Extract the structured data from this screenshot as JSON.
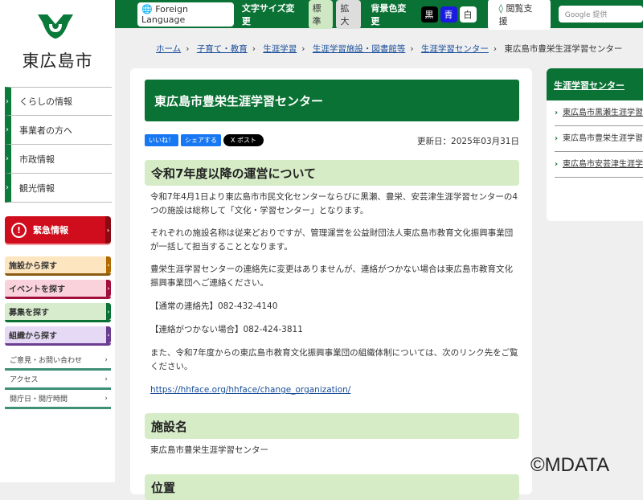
{
  "header": {
    "city_name": "東広島市",
    "foreign_language": "Foreign Language",
    "font_size_label": "文字サイズ変更",
    "font_standard": "標準",
    "font_large": "拡大",
    "bg_color_label": "背景色変更",
    "bg_black": "黒",
    "bg_blue": "青",
    "bg_white": "白",
    "browse_support": "閲覧支援",
    "search_placeholder": "Google 提供"
  },
  "global_nav": [
    "くらしの情報",
    "事業者の方へ",
    "市政情報",
    "観光情報"
  ],
  "emergency": "緊急情報",
  "find_buttons": [
    {
      "label": "施設から探す",
      "bg": "#fde5c0",
      "accent": "#b06a00"
    },
    {
      "label": "イベントを探す",
      "bg": "#fad2dc",
      "accent": "#a0103a"
    },
    {
      "label": "募集を探す",
      "bg": "#d6eccc",
      "accent": "#0a7234"
    },
    {
      "label": "組織から探す",
      "bg": "#e5d9f5",
      "accent": "#6a3d91"
    }
  ],
  "side_links": [
    "ご意見・お問い合わせ",
    "アクセス",
    "開庁日・開庁時間"
  ],
  "breadcrumb": {
    "items": [
      "ホーム",
      "子育て・教育",
      "生涯学習",
      "生涯学習施設・図書館等",
      "生涯学習センター"
    ],
    "current": "東広島市豊栄生涯学習センター"
  },
  "page": {
    "title": "東広島市豊栄生涯学習センター",
    "like": "いいね！",
    "share": "シェアする",
    "post": "X ポスト",
    "updated": "更新日：2025年03月31日",
    "section1": {
      "heading": "令和7年度以降の運営について",
      "paragraphs": [
        "令和7年4月1日より東広島市市民文化センターならびに黒瀬、豊栄、安芸津生涯学習センターの4つの施設は総称して「文化・学習センター」となります。",
        "それぞれの施設名称は従来どおりですが、管理運営を公益財団法人東広島市教育文化振興事業団が一括して担当することとなります。",
        "豊栄生涯学習センターの連絡先に変更はありませんが、連絡がつかない場合は東広島市教育文化振興事業団へご連絡ください。",
        "【通常の連絡先】082-432-4140",
        "【連絡がつかない場合】082-424-3811",
        "また、令和7年度からの東広島市教育文化振興事業団の組織体制については、次のリンク先をご覧ください。"
      ],
      "link": "https://hhface.org/hhface/change_organization/"
    },
    "section2": {
      "heading": "施設名",
      "text": "東広島市豊栄生涯学習センター"
    },
    "section3": {
      "heading": "位置"
    }
  },
  "right_sidebar": {
    "heading": "生涯学習センター",
    "items": [
      "東広島市黒瀬生涯学習センター",
      "東広島市豊栄生涯学習センター",
      "東広島市安芸津生涯学習センター"
    ]
  },
  "watermark": "©MDATA"
}
